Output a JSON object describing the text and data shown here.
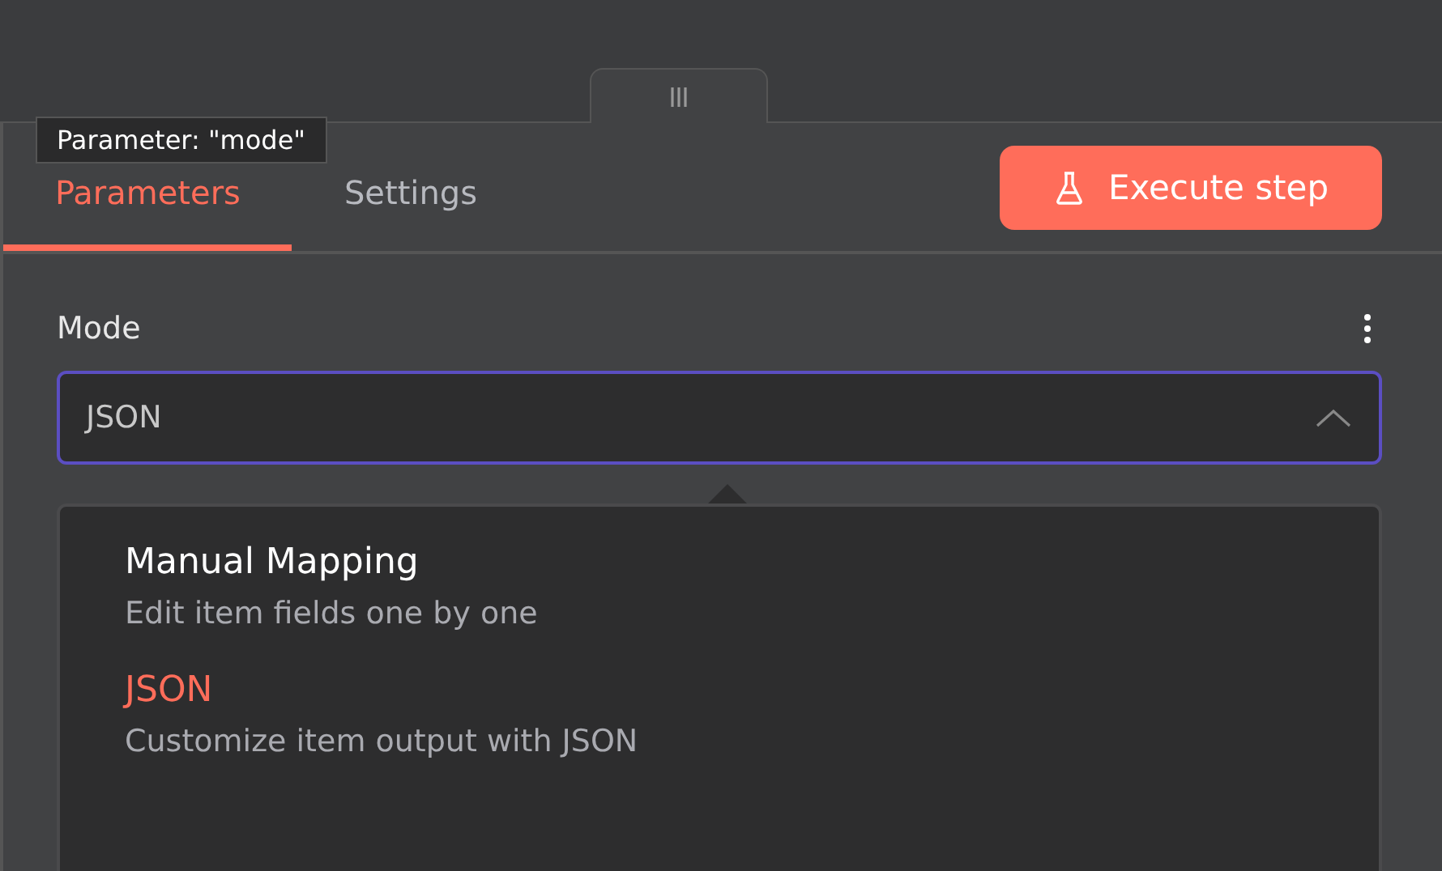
{
  "tooltip": "Parameter: \"mode\"",
  "tabs": [
    {
      "label": "Parameters",
      "selected": true
    },
    {
      "label": "Settings",
      "selected": false
    }
  ],
  "execute_button": "Execute step",
  "field": {
    "label": "Mode",
    "value": "JSON",
    "expanded": true
  },
  "options": [
    {
      "title": "Manual Mapping",
      "description": "Edit item fields one by one",
      "selected": false
    },
    {
      "title": "JSON",
      "description": "Customize item output with JSON",
      "selected": true
    }
  ]
}
